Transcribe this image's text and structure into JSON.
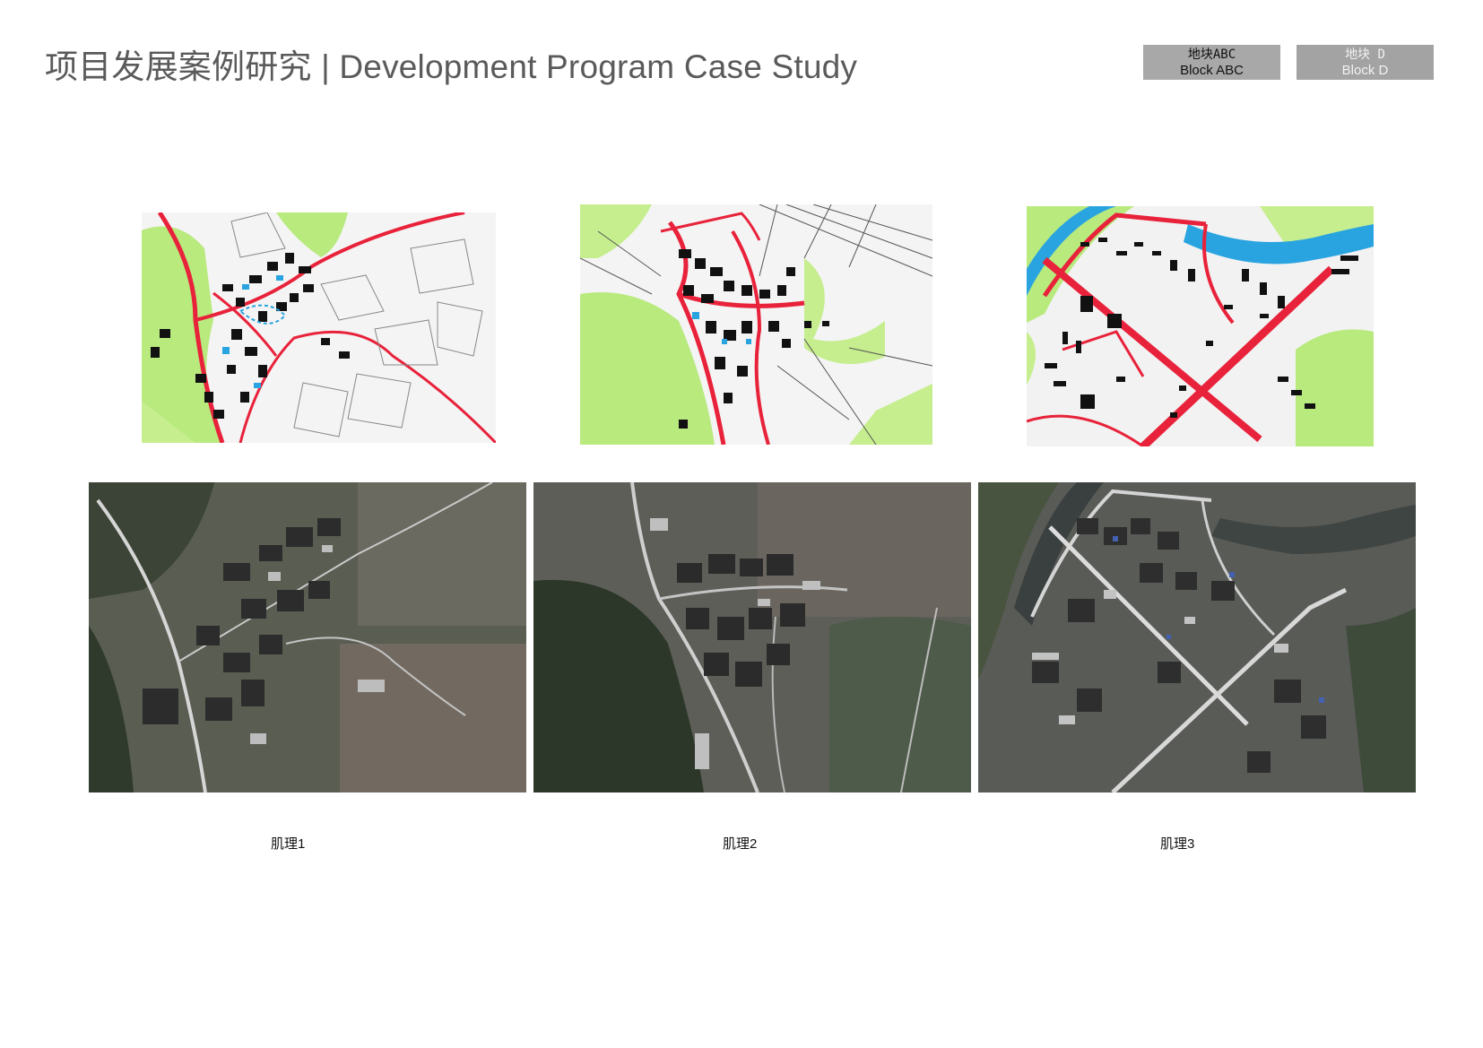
{
  "header": {
    "title": "项目发展案例研究 | Development Program Case Study"
  },
  "tabs": [
    {
      "cn": "地块ABC",
      "en": "Block ABC",
      "active": true
    },
    {
      "cn": "地块 D",
      "en": "Block D",
      "active": false
    }
  ],
  "case_studies": [
    {
      "label": "肌理1",
      "sketch_icon": "village-sketch-map",
      "photo_icon": "aerial-photo"
    },
    {
      "label": "肌理2",
      "sketch_icon": "village-sketch-map",
      "photo_icon": "aerial-photo"
    },
    {
      "label": "肌理3",
      "sketch_icon": "town-sketch-map",
      "photo_icon": "aerial-photo"
    }
  ],
  "colors": {
    "title": "#5a5a5a",
    "tab_bg": "#a3a3a3",
    "sketch_green": "#a6e36b",
    "sketch_red": "#e8223a",
    "sketch_blue": "#2aa4e0",
    "aerial_dark": "#3c4038"
  }
}
